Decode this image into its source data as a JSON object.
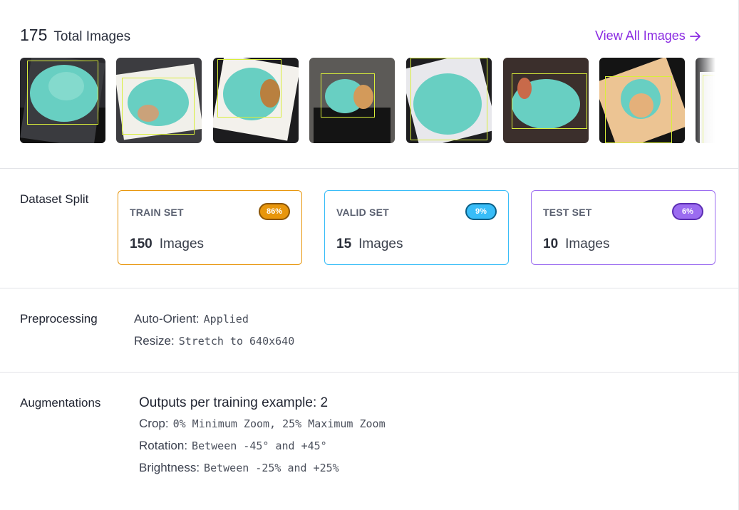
{
  "header": {
    "total_count": "175",
    "total_label": "Total Images",
    "view_all_label": "View All Images",
    "accent_color": "#8a2be2"
  },
  "thumbnails": {
    "count_visible": 8,
    "bbox_color": "#d9ee3a"
  },
  "dataset_split": {
    "label": "Dataset Split",
    "sets": [
      {
        "title": "TRAIN SET",
        "percent": "86%",
        "count": "150",
        "unit": "Images",
        "color": "#e8960c"
      },
      {
        "title": "VALID SET",
        "percent": "9%",
        "count": "15",
        "unit": "Images",
        "color": "#38bdf8"
      },
      {
        "title": "TEST SET",
        "percent": "6%",
        "count": "10",
        "unit": "Images",
        "color": "#9b6cf0"
      }
    ]
  },
  "preprocessing": {
    "label": "Preprocessing",
    "items": [
      {
        "key": "Auto-Orient:",
        "value": "Applied"
      },
      {
        "key": "Resize:",
        "value": "Stretch to 640x640"
      }
    ]
  },
  "augmentations": {
    "label": "Augmentations",
    "outputs_text": "Outputs per training example: 2",
    "items": [
      {
        "key": "Crop:",
        "value": "0% Minimum Zoom, 25% Maximum Zoom"
      },
      {
        "key": "Rotation:",
        "value": "Between -45° and +45°"
      },
      {
        "key": "Brightness:",
        "value": "Between -25% and +25%"
      }
    ]
  }
}
